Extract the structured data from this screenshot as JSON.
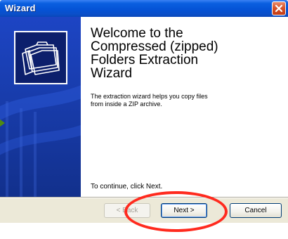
{
  "window": {
    "title": "Wizard"
  },
  "welcome": {
    "line1": "Welcome to the",
    "line2": "Compressed (zipped)",
    "line3": "Folders Extraction",
    "line4": "Wizard"
  },
  "description": {
    "line1": "The extraction wizard helps you copy files",
    "line2": "from inside a ZIP archive."
  },
  "continue_text": "To continue, click Next.",
  "buttons": {
    "back": "< Back",
    "next": "Next >",
    "cancel": "Cancel"
  },
  "colors": {
    "titlebar": "#0553d6",
    "panel": "#173aa6",
    "highlight": "#ff2a1e",
    "arrow": "#4f8a12"
  },
  "icons": [
    "close-icon",
    "folders-icon"
  ]
}
